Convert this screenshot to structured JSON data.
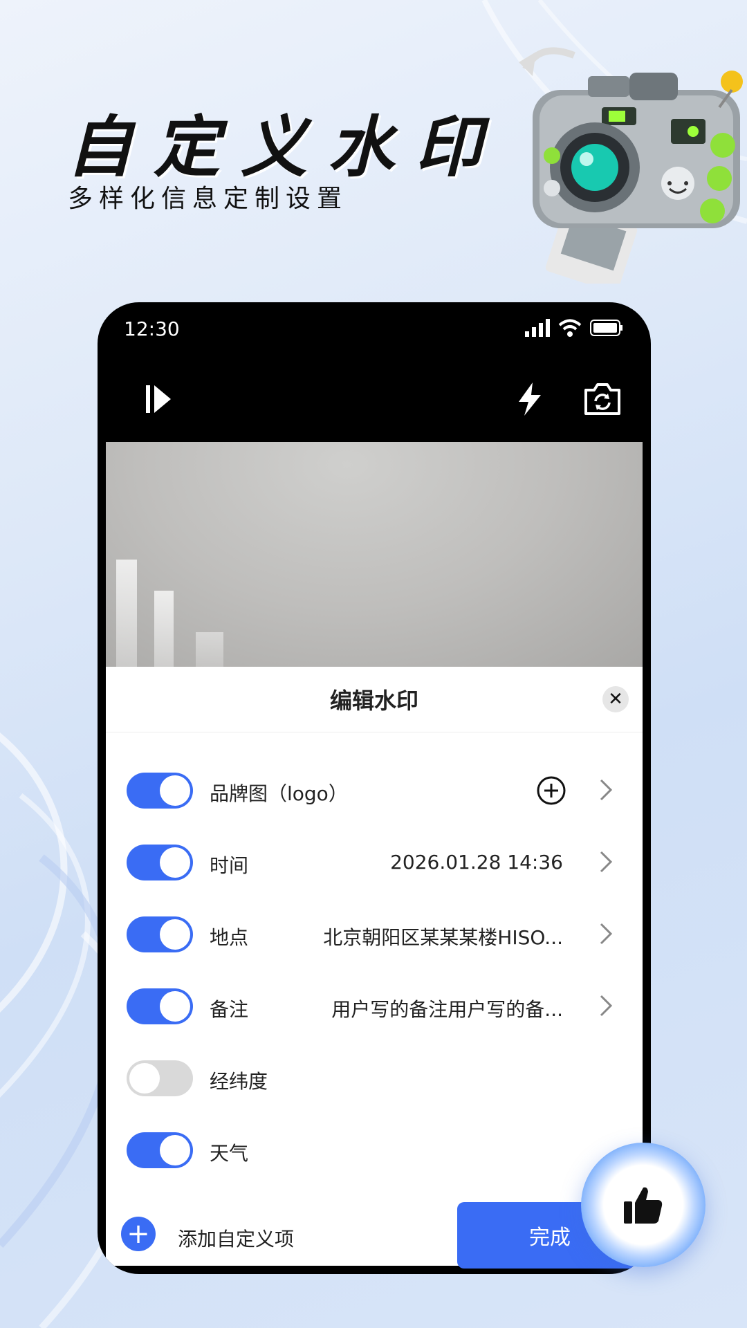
{
  "promo": {
    "headline": "自定义水印",
    "subline": "多样化信息定制设置"
  },
  "status_bar": {
    "time": "12:30"
  },
  "sheet": {
    "title": "编辑水印",
    "rows": [
      {
        "label": "品牌图（logo）",
        "value": "",
        "enabled": true
      },
      {
        "label": "时间",
        "value": "2026.01.28 14:36",
        "enabled": true
      },
      {
        "label": "地点",
        "value": "北京朝阳区某某某楼HISO...",
        "enabled": true
      },
      {
        "label": "备注",
        "value": "用户写的备注用户写的备...",
        "enabled": true
      },
      {
        "label": "经纬度",
        "value": "",
        "enabled": false
      },
      {
        "label": "天气",
        "value": "",
        "enabled": true
      }
    ],
    "add_label": "添加自定义项",
    "done_label": "完成"
  },
  "colors": {
    "accent": "#3a6cf4"
  },
  "icons": [
    "play-icon",
    "flash-icon",
    "camera-switch-icon",
    "close-icon",
    "add-circle-icon",
    "chevron-right-icon",
    "plus-icon",
    "thumbs-up-icon",
    "camera-illustration"
  ]
}
